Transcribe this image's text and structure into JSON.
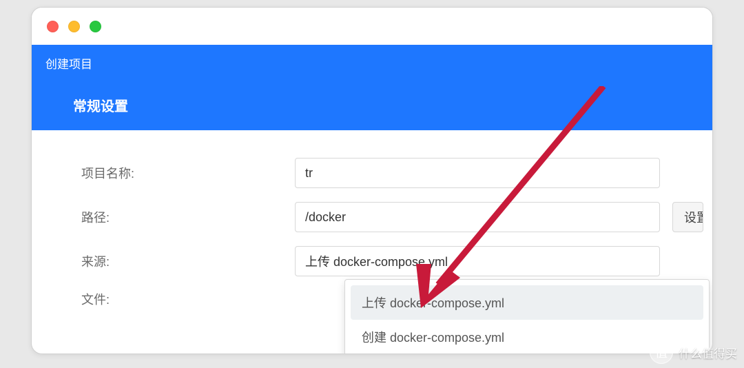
{
  "breadcrumb": "创建项目",
  "section_title": "常规设置",
  "form": {
    "project_name": {
      "label": "项目名称:",
      "value": "tr"
    },
    "path": {
      "label": "路径:",
      "value": "/docker",
      "button": "设置"
    },
    "source": {
      "label": "来源:",
      "selected": "上传 docker-compose.yml",
      "options": [
        "上传 docker-compose.yml",
        "创建 docker-compose.yml"
      ]
    },
    "file": {
      "label": "文件:"
    }
  },
  "watermark": {
    "badge": "值",
    "text": "什么值得买"
  },
  "colors": {
    "primary": "#1e77ff",
    "annotation": "#c81a3a"
  }
}
